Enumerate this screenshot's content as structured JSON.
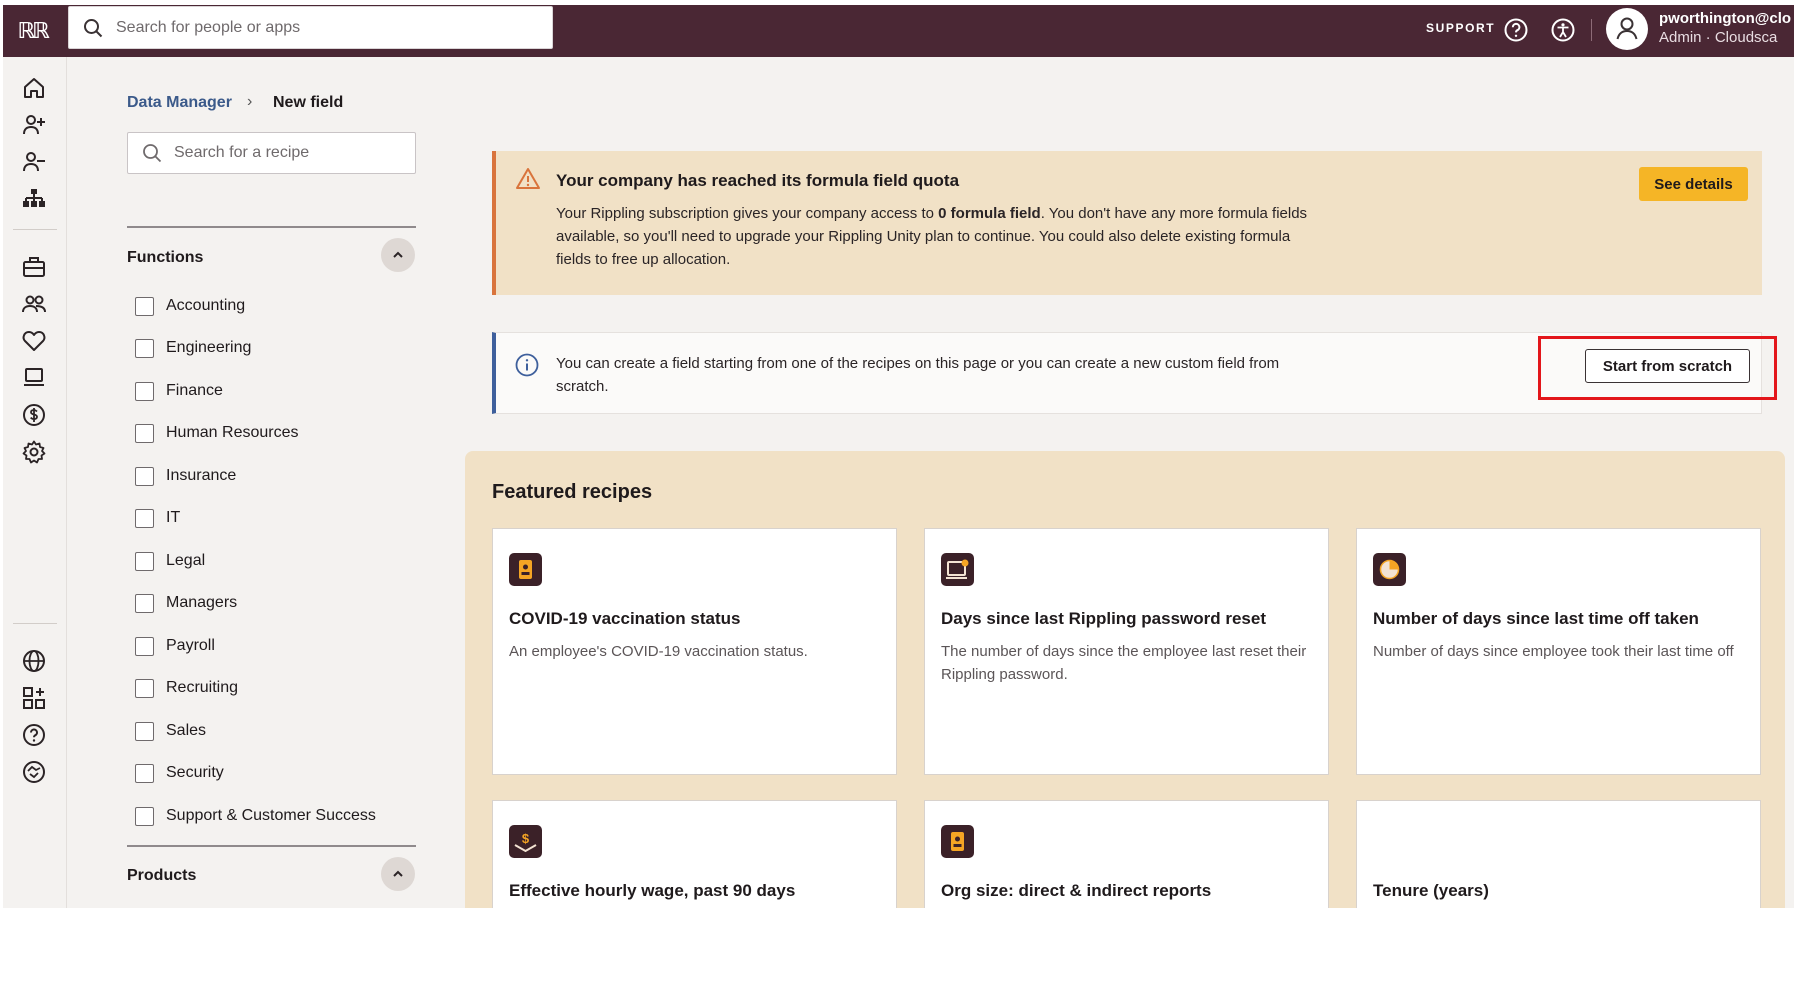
{
  "topbar": {
    "logo_text": "ℝℝ",
    "search_placeholder": "Search for people or apps",
    "support_label": "SUPPORT",
    "user_name": "pworthington@clo",
    "user_role": "Admin · Cloudsca"
  },
  "breadcrumb": {
    "parent": "Data Manager",
    "separator": "›",
    "current": "New field"
  },
  "sidebar": {
    "search_placeholder": "Search for a recipe",
    "functions_title": "Functions",
    "functions": [
      "Accounting",
      "Engineering",
      "Finance",
      "Human Resources",
      "Insurance",
      "IT",
      "Legal",
      "Managers",
      "Payroll",
      "Recruiting",
      "Sales",
      "Security",
      "Support & Customer Success"
    ],
    "products_title": "Products"
  },
  "warning": {
    "title": "Your company has reached its formula field quota",
    "body_pre": "Your Rippling subscription gives your company access to ",
    "body_bold": "0 formula field",
    "body_post": ". You don't have any more formula fields available, so you'll need to upgrade your Rippling Unity plan to continue. You could also delete existing formula fields to free up allocation.",
    "button": "See details"
  },
  "info": {
    "body": "You can create a field starting from one of the recipes on this page or you can create a new custom field from scratch.",
    "button": "Start from scratch"
  },
  "featured": {
    "title": "Featured recipes",
    "cards": [
      {
        "title": "COVID-19 vaccination status",
        "desc": "An employee's COVID-19 vaccination status.",
        "icon": "badge-icon"
      },
      {
        "title": "Days since last Rippling password reset",
        "desc": "The number of days since the employee last reset their Rippling password.",
        "icon": "monitor-icon"
      },
      {
        "title": "Number of days since last time off taken",
        "desc": "Number of days since employee took their last time off",
        "icon": "time-off-icon"
      },
      {
        "title": "Effective hourly wage, past 90 days",
        "desc": "",
        "icon": "dollar-icon"
      },
      {
        "title": "Org size: direct & indirect reports",
        "desc": "",
        "icon": "badge-icon"
      },
      {
        "title": "Tenure (years)",
        "desc": "",
        "icon": ""
      }
    ]
  },
  "colors": {
    "topbar": "#4a2734",
    "warning_bg": "#f1e1c6",
    "warning_accent": "#d9743c",
    "info_accent": "#3e5f9c",
    "button_yellow": "#f5b526",
    "highlight": "#e3161b"
  }
}
